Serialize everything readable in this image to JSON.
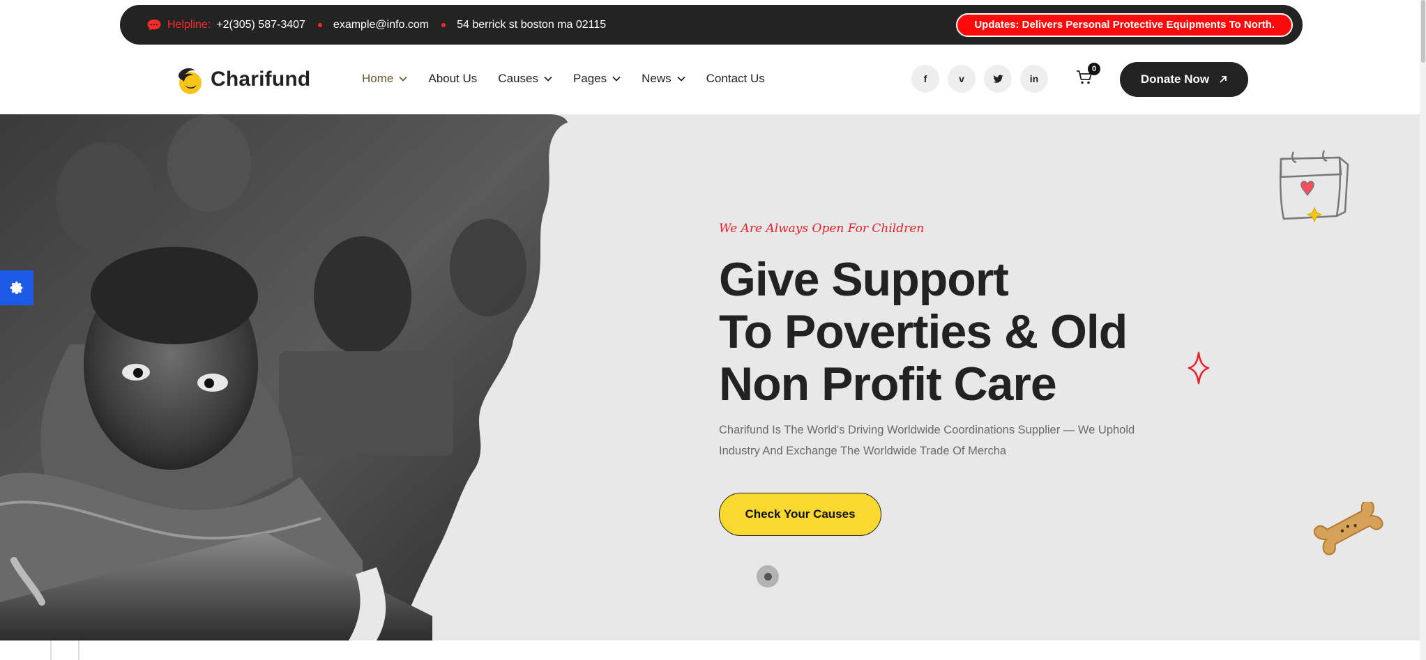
{
  "topbar": {
    "helpline_label": "Helpline:",
    "helpline_number": "+2(305) 587-3407",
    "email": "example@info.com",
    "address": "54 berrick st boston ma 02115",
    "update_text": "Updates: Delivers Personal Protective Equipments To North."
  },
  "header": {
    "logo_text": "Charifund",
    "nav": [
      {
        "label": "Home",
        "has_dropdown": true,
        "active": true
      },
      {
        "label": "About Us",
        "has_dropdown": false
      },
      {
        "label": "Causes",
        "has_dropdown": true
      },
      {
        "label": "Pages",
        "has_dropdown": true
      },
      {
        "label": "News",
        "has_dropdown": true
      },
      {
        "label": "Contact Us",
        "has_dropdown": false
      }
    ],
    "socials": [
      {
        "label": "f",
        "icon": "facebook-icon"
      },
      {
        "label": "v",
        "icon": "vimeo-icon"
      },
      {
        "label": "t",
        "icon": "twitter-icon"
      },
      {
        "label": "in",
        "icon": "linkedin-icon"
      }
    ],
    "cart_count": "0",
    "donate_label": "Donate Now"
  },
  "hero": {
    "tagline": "We Are Always Open For Children",
    "title_line1": "Give Support",
    "title_line2": "To Poverties & Old",
    "title_line3": "Non Profit Care",
    "description": "Charifund Is The World's Driving Worldwide Coordinations Supplier — We Uphold Industry And Exchange The Worldwide Trade Of Mercha",
    "cta_label": "Check Your Causes"
  },
  "colors": {
    "accent_red": "#ff0a0a",
    "accent_yellow": "#f9d92f",
    "dark": "#232323",
    "hero_bg": "#e8e8e8",
    "settings_blue": "#1d5ae6"
  }
}
